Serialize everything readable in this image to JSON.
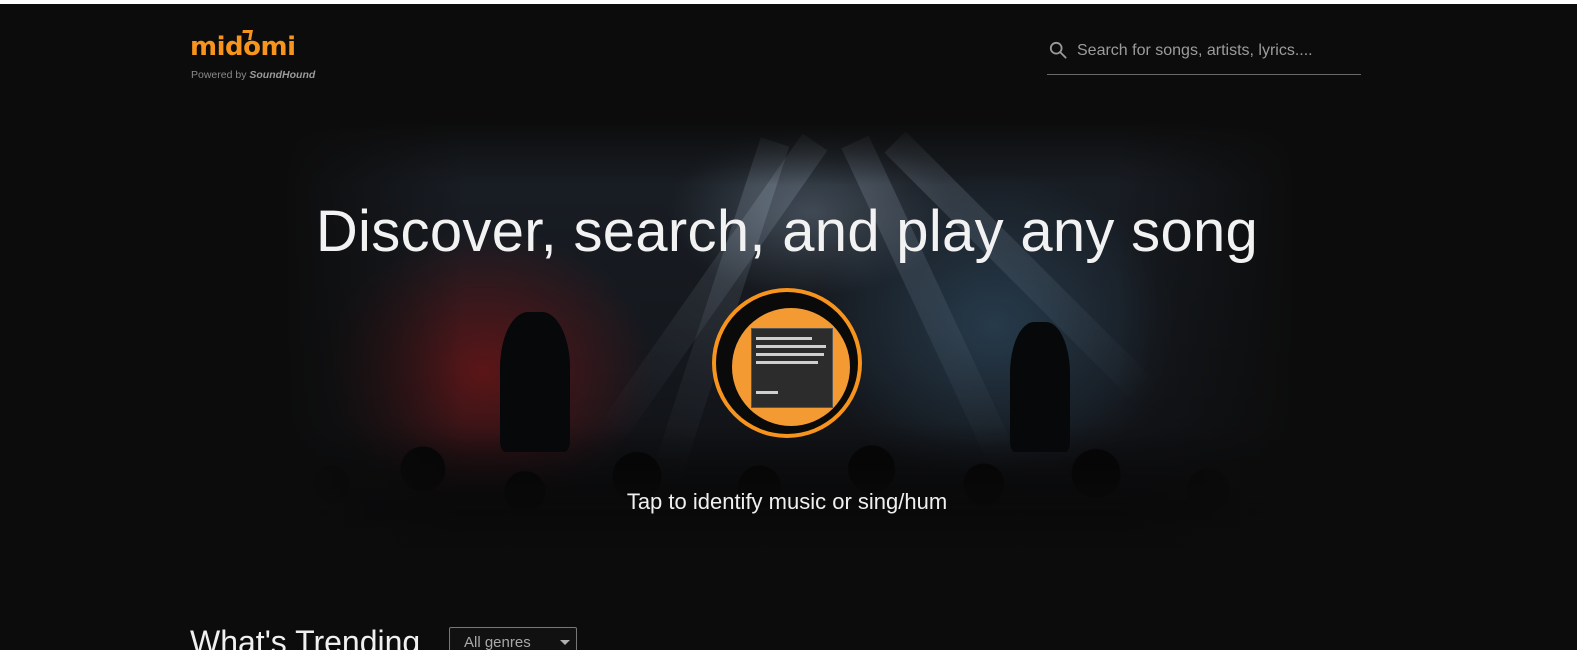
{
  "brand": {
    "logo_text": "midomi",
    "powered_prefix": "Powered by",
    "powered_brand": "SoundHound",
    "accent_color": "#f7941d"
  },
  "search": {
    "icon": "search-icon",
    "placeholder": "Search for songs, artists, lyrics...."
  },
  "hero": {
    "title": "Discover, search, and play any song",
    "listen_button_icon": "broken-image-placeholder",
    "placeholder_text": "The image you are requesting does not exist or is no longer available",
    "placeholder_footer": "imgur.com",
    "caption": "Tap to identify music or sing/hum"
  },
  "trending": {
    "title": "What's Trending",
    "genre_selected": "All genres"
  }
}
